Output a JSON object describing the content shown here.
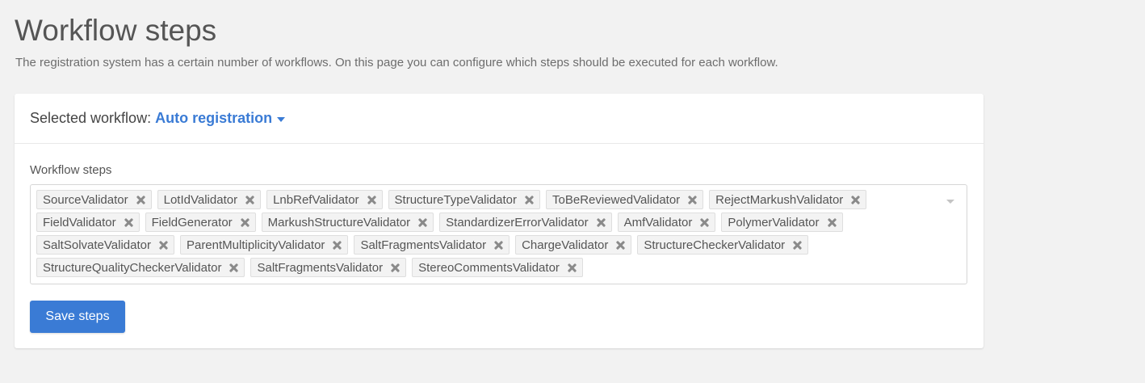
{
  "page": {
    "title": "Workflow steps",
    "description": "The registration system has a certain number of workflows. On this page you can configure which steps should be executed for each workflow."
  },
  "workflow": {
    "label": "Selected workflow:",
    "selected": "Auto registration"
  },
  "steps": {
    "label": "Workflow steps",
    "items": [
      "SourceValidator",
      "LotIdValidator",
      "LnbRefValidator",
      "StructureTypeValidator",
      "ToBeReviewedValidator",
      "RejectMarkushValidator",
      "FieldValidator",
      "FieldGenerator",
      "MarkushStructureValidator",
      "StandardizerErrorValidator",
      "AmfValidator",
      "PolymerValidator",
      "SaltSolvateValidator",
      "ParentMultiplicityValidator",
      "SaltFragmentsValidator",
      "ChargeValidator",
      "StructureCheckerValidator",
      "StructureQualityCheckerValidator",
      "SaltFragmentsValidator",
      "StereoCommentsValidator"
    ],
    "remove_icon": "close-icon",
    "dropdown_icon": "chevron-down-icon"
  },
  "actions": {
    "save_label": "Save steps"
  },
  "colors": {
    "accent": "#3a7bd5",
    "background": "#f2f2f2",
    "card": "#ffffff"
  }
}
